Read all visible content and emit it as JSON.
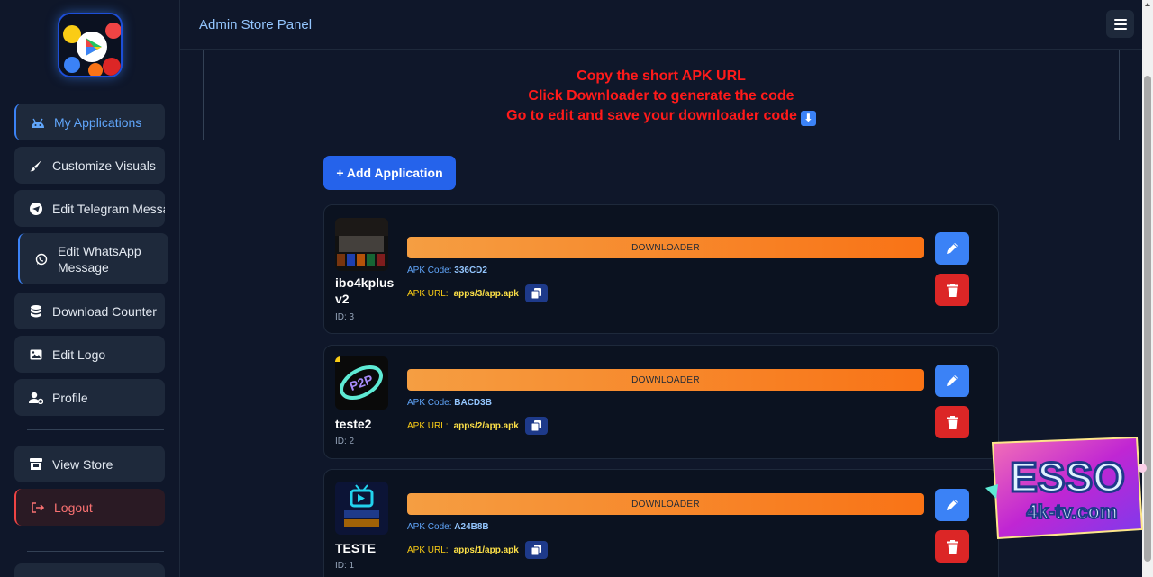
{
  "header": {
    "title": "Admin Store Panel"
  },
  "sidebar": {
    "items": [
      {
        "label": "My Applications",
        "icon": "android-icon"
      },
      {
        "label": "Customize Visuals",
        "icon": "brush-icon"
      },
      {
        "label": "Edit Telegram Message",
        "icon": "telegram-icon"
      },
      {
        "label": "Edit WhatsApp Message",
        "icon": "whatsapp-icon"
      },
      {
        "label": "Download Counter",
        "icon": "database-icon"
      },
      {
        "label": "Edit Logo",
        "icon": "image-icon"
      },
      {
        "label": "Profile",
        "icon": "user-gear-icon"
      },
      {
        "label": "View Store",
        "icon": "store-icon"
      },
      {
        "label": "Logout",
        "icon": "logout-icon"
      }
    ]
  },
  "notice": {
    "lines": [
      "Copy the short APK URL",
      "Click Downloader to generate the code",
      "Go to edit and save your downloader code"
    ],
    "emoji": "⬇"
  },
  "actions": {
    "add_label": "+ Add Application"
  },
  "apps": [
    {
      "name": "ibo4kplus v2",
      "id_label": "ID: 3",
      "downloader_label": "DOWNLOADER",
      "code_label": "APK Code:",
      "code": "336CD2",
      "url_label": "APK URL:",
      "url": "apps/3/app.apk"
    },
    {
      "name": "teste2",
      "id_label": "ID: 2",
      "downloader_label": "DOWNLOADER",
      "code_label": "APK Code:",
      "code": "BACD3B",
      "url_label": "APK URL:",
      "url": "apps/2/app.apk"
    },
    {
      "name": "TESTE",
      "id_label": "ID: 1",
      "downloader_label": "DOWNLOADER",
      "code_label": "APK Code:",
      "code": "A24B8B",
      "url_label": "APK URL:",
      "url": "apps/1/app.apk"
    }
  ],
  "watermark": {
    "line1": "ESSO",
    "line2": "4k-tv.com"
  },
  "colors": {
    "accent": "#2563eb",
    "danger": "#dc2626",
    "downloader": "#f97316",
    "notice": "#ff1a1a"
  }
}
